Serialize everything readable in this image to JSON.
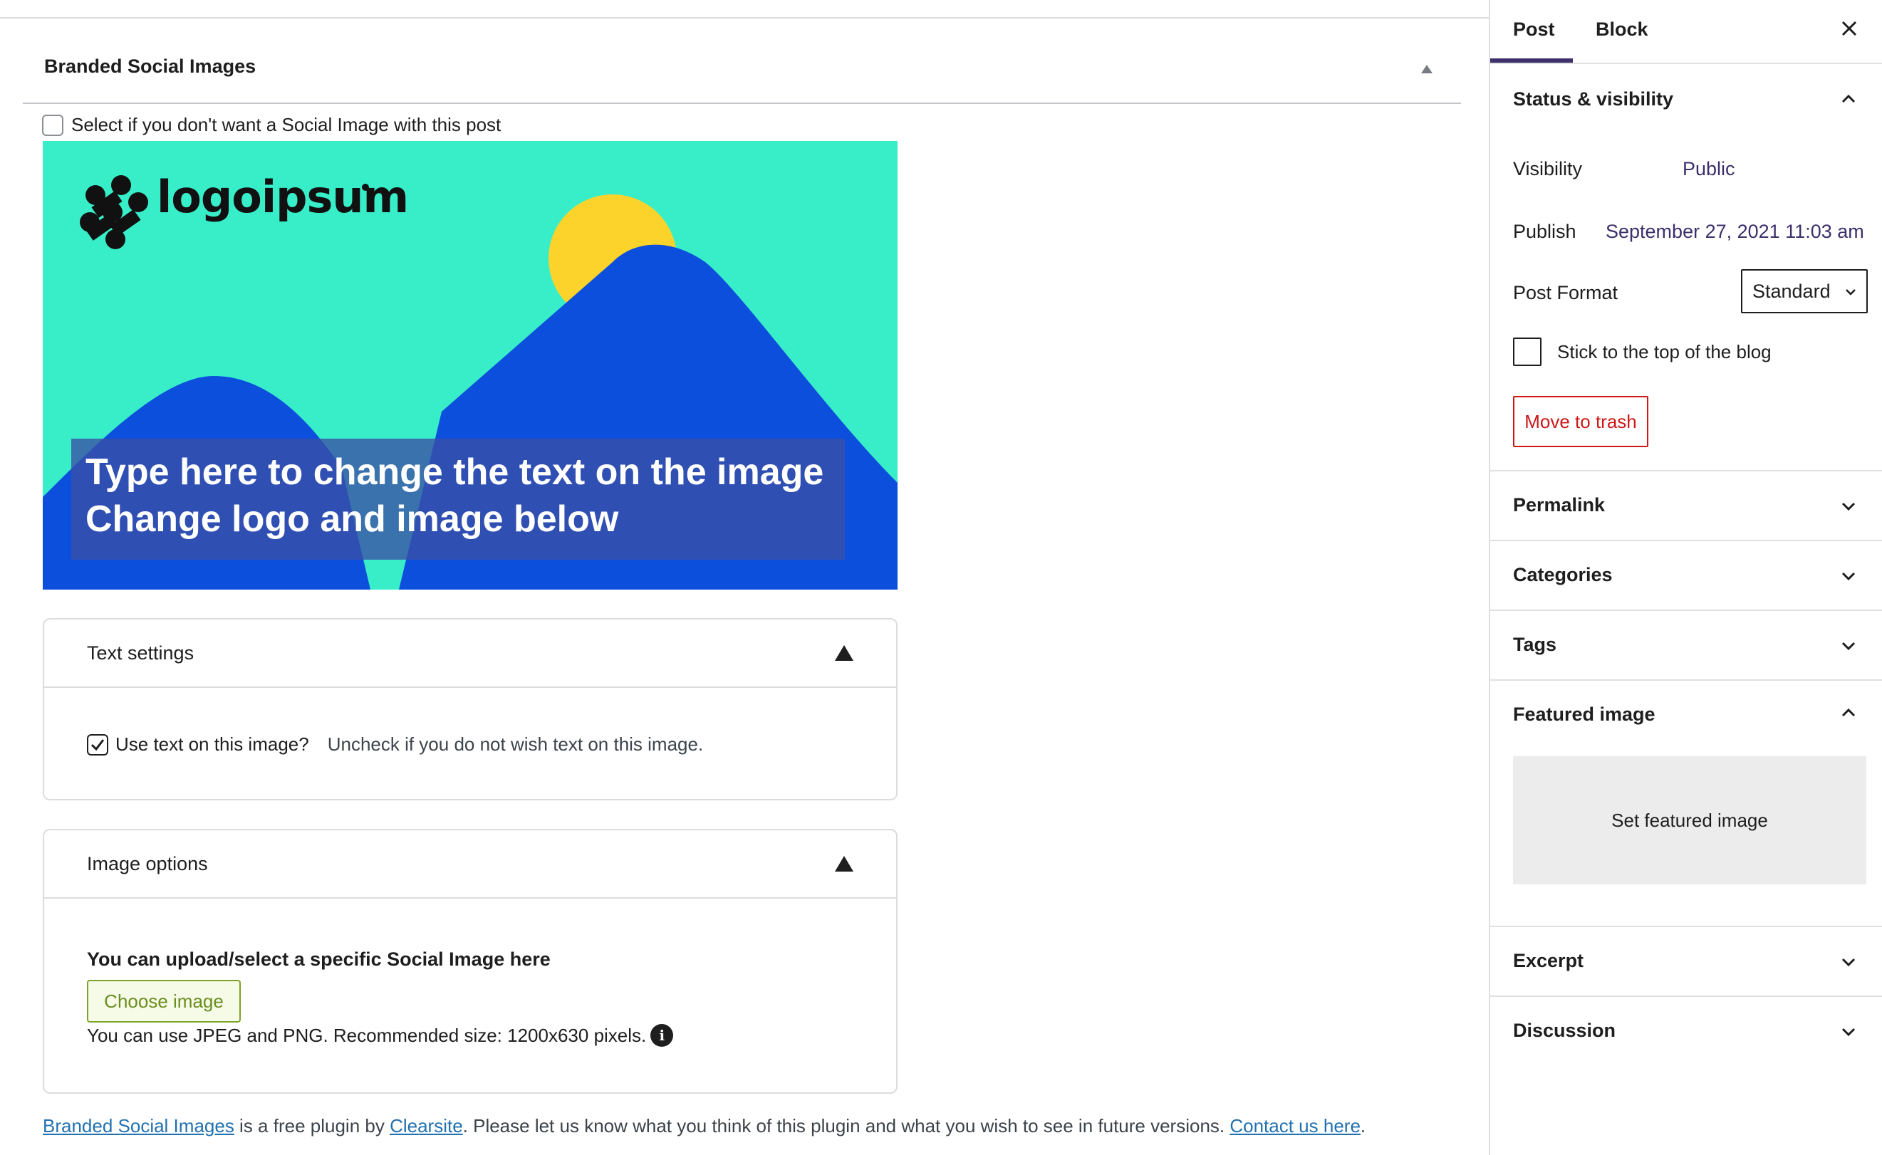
{
  "metabox": {
    "title": "Branded Social Images",
    "optout_label": "Select if you don't want a Social Image with this post"
  },
  "preview": {
    "logo_text": "logoipsum",
    "overlay_line1": "Type here to change the text on the image",
    "overlay_line2": "Change logo and image below",
    "colors": {
      "background": "#38EEC9",
      "mountain": "#0C4FDD",
      "sun": "#FCD32A",
      "overlay": "#3B4FA5"
    }
  },
  "text_settings": {
    "title": "Text settings",
    "checkbox_label": "Use text on this image?",
    "checkbox_checked": true,
    "hint": "Uncheck if you do not wish text on this image."
  },
  "image_options": {
    "title": "Image options",
    "heading": "You can upload/select a specific Social Image here",
    "choose_button": "Choose image",
    "hint": "You can use JPEG and PNG. Recommended size: 1200x630 pixels."
  },
  "footer": {
    "link1": "Branded Social Images",
    "text1": " is a free plugin by ",
    "link2": "Clearsite",
    "text2": ". Please let us know what you think of this plugin and what you wish to see in future versions. ",
    "link3": "Contact us here",
    "text3": "."
  },
  "sidebar": {
    "tabs": [
      "Post",
      "Block"
    ],
    "active_tab": "Post",
    "status": {
      "title": "Status & visibility",
      "visibility_label": "Visibility",
      "visibility_value": "Public",
      "publish_label": "Publish",
      "publish_value": "September 27, 2021 11:03 am",
      "format_label": "Post Format",
      "format_value": "Standard",
      "sticky_label": "Stick to the top of the blog",
      "trash_button": "Move to trash"
    },
    "sections": {
      "permalink": "Permalink",
      "categories": "Categories",
      "tags": "Tags",
      "featured": "Featured image",
      "featured_button": "Set featured image",
      "excerpt": "Excerpt",
      "discussion": "Discussion"
    },
    "accent_color": "#3C2F6B",
    "danger_color": "#CC1818"
  }
}
